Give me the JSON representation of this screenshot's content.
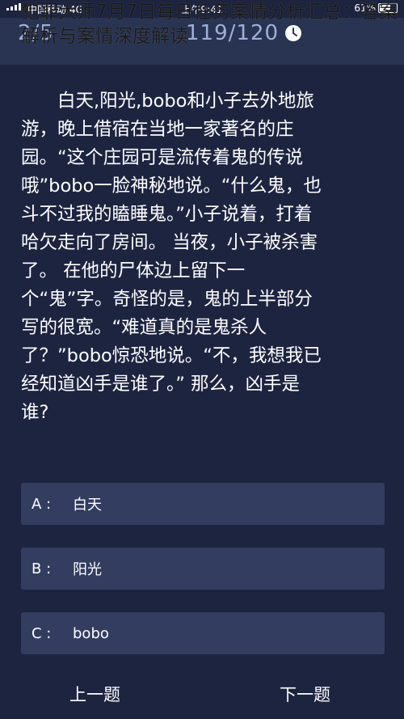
{
  "status_bar": {
    "carrier": "中国移动 4G",
    "time": "上午9:41",
    "battery": "61%"
  },
  "header": {
    "progress": "2/5",
    "timer": "119/120"
  },
  "article_title": "犯罪大师7月7日每日任务案情分析汇总：答案解析与案情深度解读",
  "question": {
    "lines": [
      "　　白天,阳光,bobo和小子去外地旅",
      "游，晚上借宿在当地一家著名的庄",
      "园。“这个庄园可是流传着鬼的传说",
      "哦”bobo一脸神秘地说。“什么鬼，也",
      "斗不过我的瞌睡鬼。”小子说着，打着",
      "哈欠走向了房间。 当夜，小子被杀害",
      "了。 在他的尸体边上留下一",
      "个“鬼”字。奇怪的是，鬼的上半部分",
      "写的很宽。“难道真的是鬼杀人",
      "了？”bobo惊恐地说。“不，我想我已",
      "经知道凶手是谁了。” 那么，凶手是",
      "谁?"
    ]
  },
  "options": [
    {
      "letter": "A :",
      "text": "白天"
    },
    {
      "letter": "B :",
      "text": "阳光"
    },
    {
      "letter": "C :",
      "text": "bobo"
    }
  ],
  "nav": {
    "prev": "上一题",
    "next": "下一题"
  },
  "colors": {
    "background": "#1d2440",
    "header": "#293352",
    "option_bg": "#333d60",
    "counter_text": "#9fb0d6"
  }
}
